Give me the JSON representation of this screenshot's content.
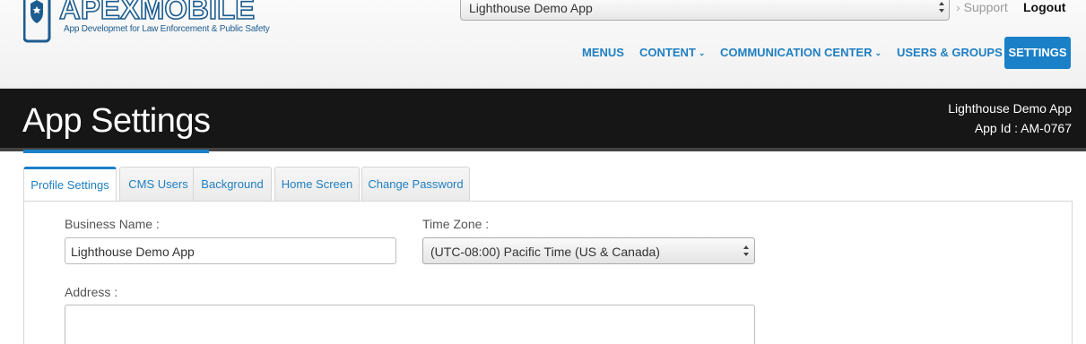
{
  "brand": {
    "logo_text": "APEXMOBILE",
    "tagline": "App Developmet for Law Enforcement & Public Safety",
    "colors": {
      "brand_blue": "#1d5c8f",
      "accent": "#1a80c8"
    }
  },
  "header": {
    "app_selector_value": "Lighthouse Demo App",
    "support_label": "Support",
    "logout_label": "Logout"
  },
  "nav": {
    "items": [
      {
        "label": "MENUS",
        "has_caret": false
      },
      {
        "label": "CONTENT",
        "has_caret": true
      },
      {
        "label": "COMMUNICATION CENTER",
        "has_caret": true
      },
      {
        "label": "USERS & GROUPS",
        "has_caret": false
      },
      {
        "label": "SETTINGS",
        "active": true
      }
    ]
  },
  "page": {
    "title": "App Settings",
    "app_name": "Lighthouse Demo App",
    "app_id": "App Id : AM-0767"
  },
  "tabs": [
    {
      "label": "Profile Settings",
      "active": true
    },
    {
      "label": "CMS Users"
    },
    {
      "label": "Background"
    },
    {
      "label": "Home Screen"
    },
    {
      "label": "Change Password"
    }
  ],
  "form": {
    "business_name_label": "Business Name :",
    "business_name_value": "Lighthouse Demo App",
    "time_zone_label": "Time Zone :",
    "time_zone_value": "(UTC-08:00) Pacific Time (US & Canada)",
    "address_label": "Address :",
    "address_value": ""
  }
}
